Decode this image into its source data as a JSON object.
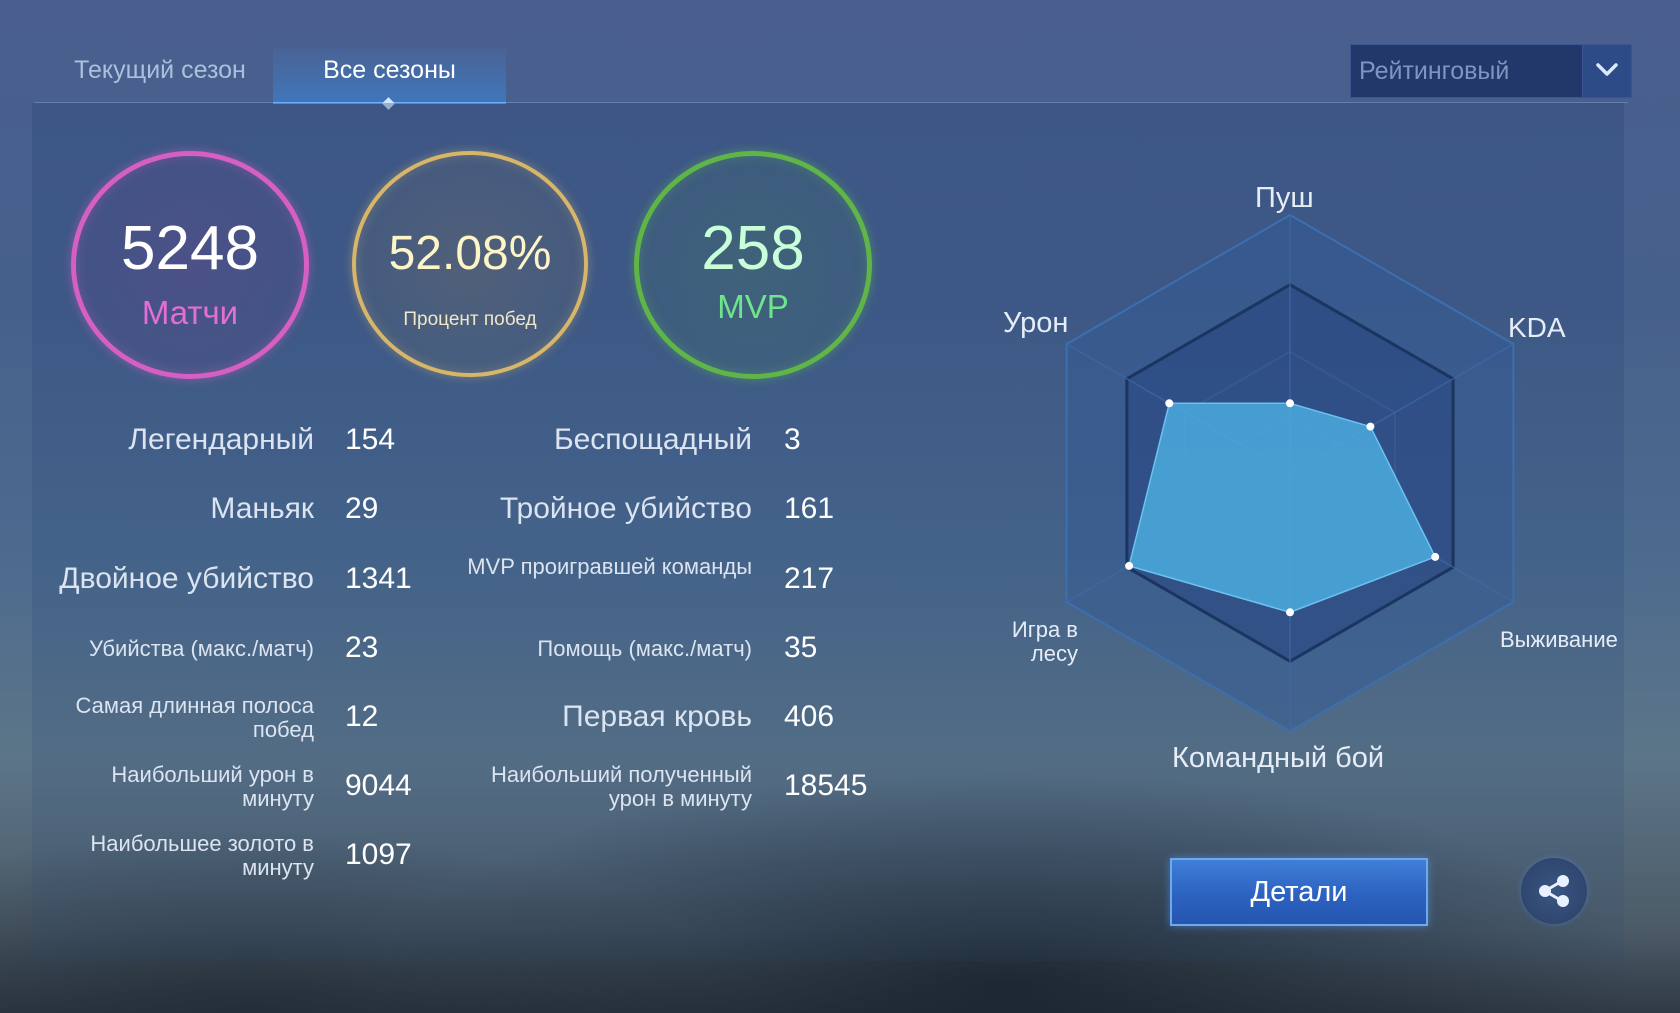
{
  "tabs": {
    "current": "Текущий сезон",
    "all": "Все сезоны"
  },
  "mode": {
    "selected": "Рейтинговый"
  },
  "summary": {
    "matches": {
      "value": "5248",
      "label": "Матчи"
    },
    "winrate": {
      "value": "52.08%",
      "label": "Процент побед"
    },
    "mvp": {
      "value": "258",
      "label": "MVP"
    }
  },
  "stats_left": [
    {
      "label": "Легендарный",
      "value": "154"
    },
    {
      "label": "Маньяк",
      "value": "29"
    },
    {
      "label": "Двойное убийство",
      "value": "1341"
    },
    {
      "label": "Убийства (макс./матч)",
      "value": "23"
    },
    {
      "label": "Самая длинная полоса побед",
      "value": "12"
    },
    {
      "label": "Наибольший урон в минуту",
      "value": "9044"
    },
    {
      "label": "Наибольшее золото в минуту",
      "value": "1097"
    }
  ],
  "stats_right": [
    {
      "label": "Беспощадный",
      "value": "3"
    },
    {
      "label": "Тройное убийство",
      "value": "161"
    },
    {
      "label": "MVP проигравшей команды",
      "value": "217"
    },
    {
      "label": "Помощь (макс./матч)",
      "value": "35"
    },
    {
      "label": "Первая кровь",
      "value": "406"
    },
    {
      "label": "Наибольший полученный урон в минуту",
      "value": "18545"
    }
  ],
  "radar": {
    "labels": [
      "Пуш",
      "KDA",
      "Выживание",
      "Командный бой",
      "Игра в лесу",
      "Урон"
    ],
    "values": [
      0.27,
      0.36,
      0.65,
      0.54,
      0.72,
      0.54
    ],
    "colors": {
      "fill": "#4aa8dc",
      "grid": "#1c3460",
      "point": "#ffffff"
    }
  },
  "actions": {
    "details": "Детали"
  },
  "icons": {
    "dropdown": "chevron-down-icon",
    "share": "share-icon"
  }
}
